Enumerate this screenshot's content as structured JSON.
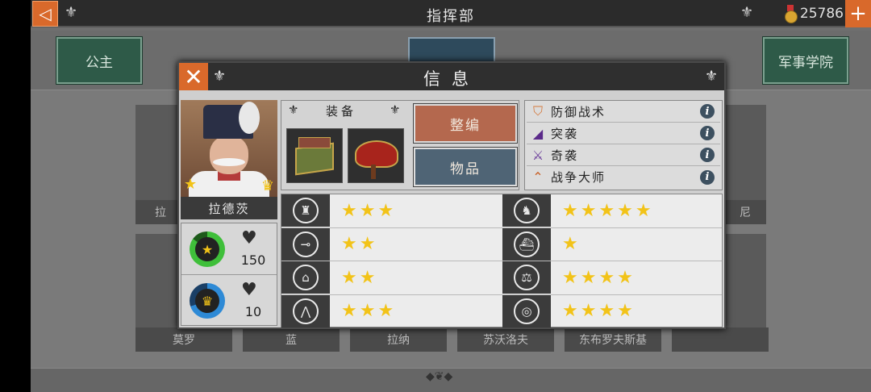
{
  "topbar": {
    "title": "指挥部",
    "gold": "25786",
    "back_icon": "back-arrow-icon",
    "plus_icon": "plus-icon"
  },
  "tabs": {
    "left": "公主",
    "right": "军事学院"
  },
  "roster": {
    "bottom_names": [
      "莫罗",
      "蓝",
      "拉纳",
      "苏沃洛夫",
      "东布罗夫斯基",
      ""
    ],
    "top_left_partial": "拉",
    "top_right_partial": "尼"
  },
  "modal": {
    "title": "信息",
    "close_icon": "close-icon",
    "hero": {
      "name": "拉德茨",
      "health": "150",
      "recovery": "10"
    },
    "equipment": {
      "title": "装备",
      "items": [
        "book-stack-icon",
        "saddle-icon"
      ],
      "reorganize_label": "整编",
      "items_label": "物品"
    },
    "skills": [
      {
        "name": "防御战术",
        "icon": "shield-icon",
        "color": "#d4773a"
      },
      {
        "name": "突袭",
        "icon": "wing-icon",
        "color": "#5b2a8a"
      },
      {
        "name": "奇袭",
        "icon": "crossed-swords-icon",
        "color": "#6a3b9a"
      },
      {
        "name": "战争大师",
        "icon": "chevron-rank-icon",
        "color": "#c8632a"
      }
    ],
    "attributes": [
      {
        "name": "infantry",
        "icon": "infantry-icon",
        "glyph": "♜",
        "stars": 3
      },
      {
        "name": "cavalry",
        "icon": "horse-icon",
        "glyph": "♞",
        "stars": 5
      },
      {
        "name": "artillery",
        "icon": "cannon-icon",
        "glyph": "⊸",
        "stars": 2
      },
      {
        "name": "navy",
        "icon": "ship-icon",
        "glyph": "⛴",
        "stars": 1
      },
      {
        "name": "fortification",
        "icon": "fort-icon",
        "glyph": "⌂",
        "stars": 2
      },
      {
        "name": "economy",
        "icon": "scales-icon",
        "glyph": "⚖",
        "stars": 4
      },
      {
        "name": "logistics",
        "icon": "tent-icon",
        "glyph": "⋀",
        "stars": 3
      },
      {
        "name": "command",
        "icon": "target-icon",
        "glyph": "◎",
        "stars": 4
      }
    ]
  }
}
